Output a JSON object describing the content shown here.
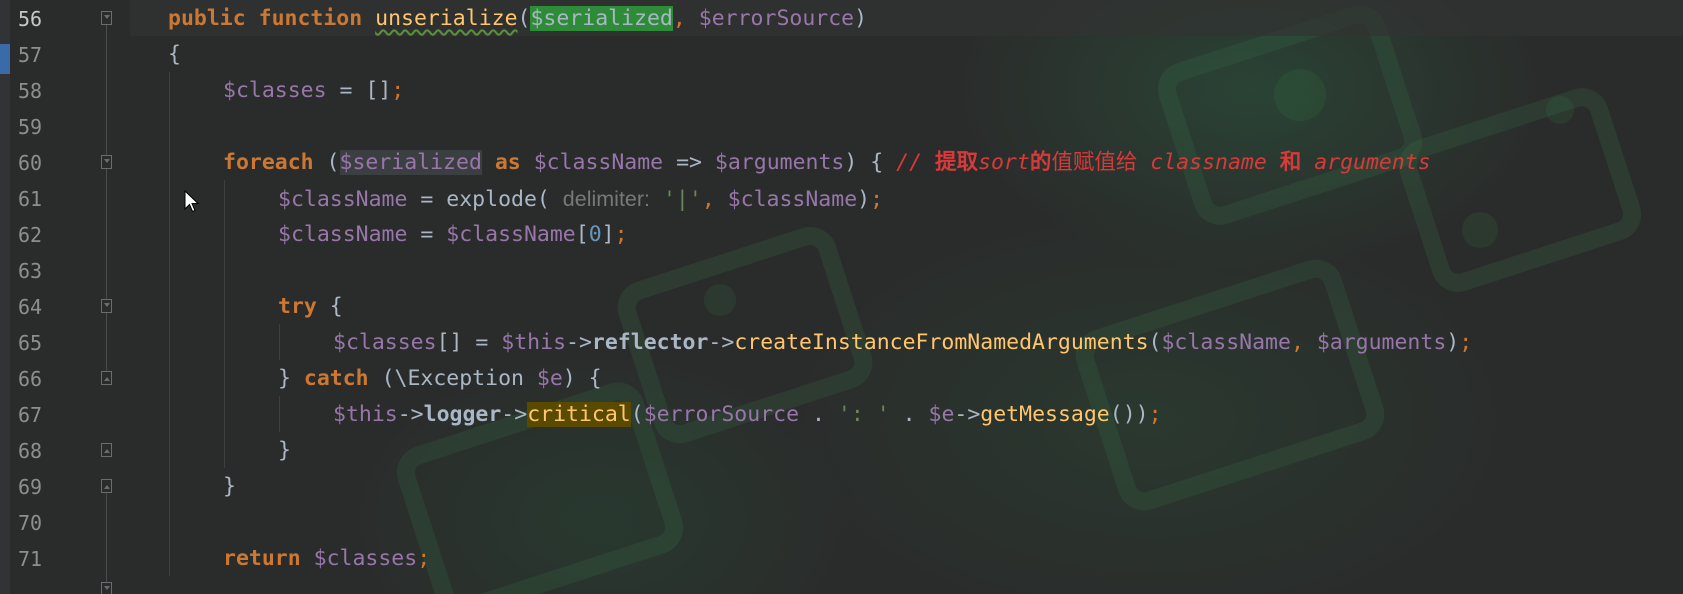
{
  "editor": {
    "line_numbers": [
      "56",
      "57",
      "58",
      "59",
      "60",
      "61",
      "62",
      "63",
      "64",
      "65",
      "66",
      "67",
      "68",
      "69",
      "70",
      "71"
    ],
    "lines": {
      "l56": {
        "kw_public": "public",
        "kw_function": "function",
        "fn_name": "unserialize",
        "paren_open": "(",
        "param1": "$serialized",
        "comma": ",",
        "param2": "$errorSource",
        "paren_close": ")"
      },
      "l57": {
        "brace": "{"
      },
      "l58": {
        "var": "$classes",
        "op": " = ",
        "arr": "[]",
        "semi": ";"
      },
      "l60": {
        "kw_foreach": "foreach",
        "paren_open": " (",
        "var_serialized": "$serialized",
        "kw_as": "as",
        "var_classname": "$className",
        "arrow": " => ",
        "var_arguments": "$arguments",
        "tail": ") {",
        "comment_start": "// ",
        "comment_cjk1": "提取",
        "comment_sort": "sort",
        "comment_cjk2": "的",
        "comment_cjk3": "值赋值给",
        "comment_classname": " classname ",
        "comment_cjk4": "和",
        "comment_arguments": " arguments"
      },
      "l61": {
        "var": "$className",
        "op": " = ",
        "fn": "explode",
        "paren": "( ",
        "hint": "delimiter:",
        "str": "'|'",
        "comma": ", ",
        "var2": "$className",
        "close": ")",
        "semi": ";"
      },
      "l62": {
        "var": "$className",
        "op": " = ",
        "var2": "$className",
        "open": "[",
        "num": "0",
        "close": "]",
        "semi": ";"
      },
      "l64": {
        "kw": "try",
        "brace": " {"
      },
      "l65": {
        "var": "$classes",
        "arr": "[] = ",
        "this": "$this",
        "arrow1": "->",
        "prop": "reflector",
        "arrow2": "->",
        "fn": "createInstanceFromNamedArguments",
        "open": "(",
        "arg1": "$className",
        "comma": ", ",
        "arg2": "$arguments",
        "close": ")",
        "semi": ";"
      },
      "l66": {
        "close": "} ",
        "kw": "catch",
        "open": " (\\Exception ",
        "var": "$e",
        "tail": ") {"
      },
      "l67": {
        "this": "$this",
        "arrow1": "->",
        "prop": "logger",
        "arrow2": "->",
        "fn": "critical",
        "open": "(",
        "var": "$errorSource",
        "dot1": " . ",
        "str": "': '",
        "dot2": " . ",
        "var2": "$e",
        "arrow3": "->",
        "fn2": "getMessage",
        "close": "())",
        "semi": ";"
      },
      "l68": {
        "brace": "}"
      },
      "l69": {
        "brace": "}"
      },
      "l71": {
        "kw": "return",
        "var": "$classes",
        "semi": ";"
      }
    }
  },
  "colors": {
    "background": "#2b2b2b",
    "keyword": "#cc7832",
    "function": "#ffc66d",
    "variable": "#9876aa",
    "string": "#6a8759",
    "number": "#6897bb",
    "comment": "#d63a3a",
    "highlight_green": "#2e8b37"
  },
  "icons": [
    "fold-icon",
    "mouse-cursor-icon"
  ]
}
